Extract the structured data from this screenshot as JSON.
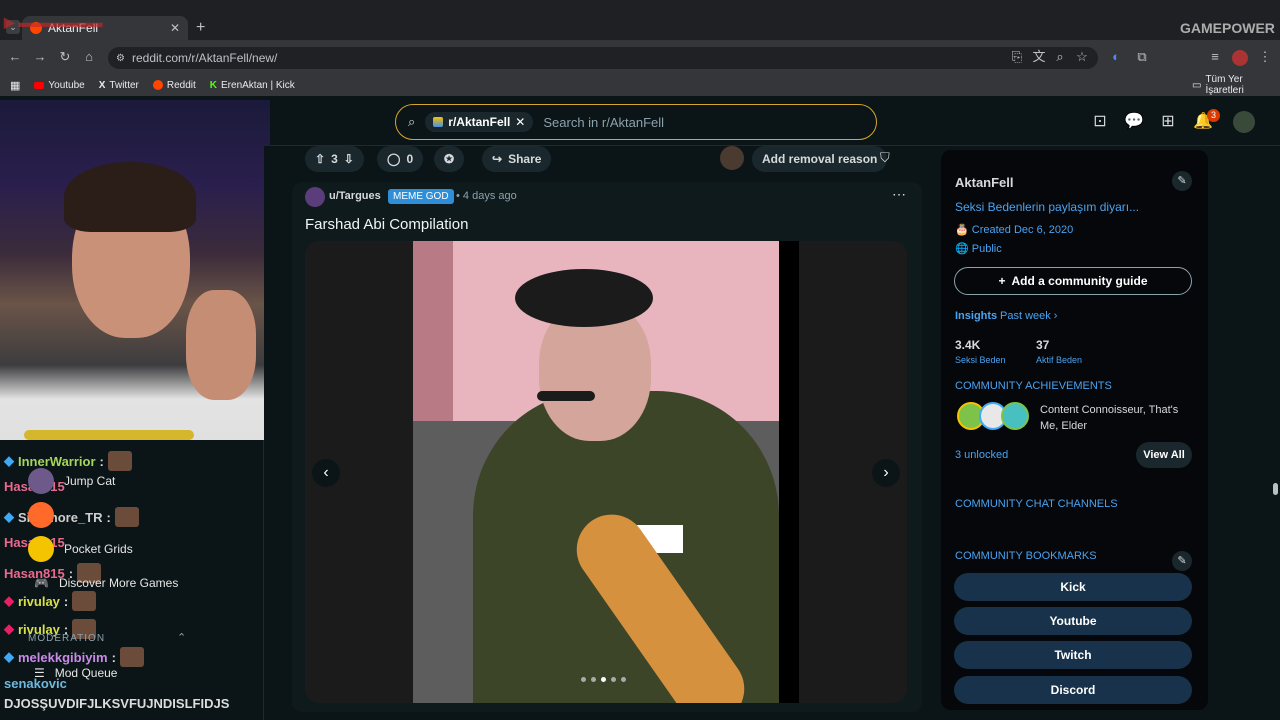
{
  "browser": {
    "tab_title": "AktanFell",
    "url": "reddit.com/r/AktanFell/new/",
    "bookmarks": [
      "Youtube",
      "Twitter",
      "Reddit",
      "ErenAktan | Kick"
    ],
    "all_bookmarks": "Tüm Yer İşaretleri",
    "overlay_brand": "GAMEPOWER"
  },
  "header": {
    "community_chip": "r/AktanFell",
    "search_placeholder": "Search in r/AktanFell",
    "notification_count": "3"
  },
  "post_actions": {
    "votes": "3",
    "comments": "0",
    "share": "Share",
    "removal": "Add removal reason"
  },
  "post": {
    "author": "u/Targues",
    "flair": "MEME GOD",
    "time": "4 days ago",
    "title": "Farshad Abi Compilation"
  },
  "sidebar": {
    "name": "AktanFell",
    "description": "Seksi Bedenlerin paylaşım diyarı...",
    "created": "Created Dec 6, 2020",
    "visibility": "Public",
    "guide_button": "Add a community guide",
    "insights_label": "Insights",
    "insights_period": "Past week",
    "stat1_value": "3.4K",
    "stat1_label": "Seksi Beden",
    "stat2_value": "37",
    "stat2_label": "Aktif Beden",
    "achievements_heading": "COMMUNITY ACHIEVEMENTS",
    "achievements_text": "Content Connoisseur, That's Me, Elder",
    "unlocked": "3 unlocked",
    "view_all": "View All",
    "chat_heading": "COMMUNITY CHAT CHANNELS",
    "bookmarks_heading": "COMMUNITY BOOKMARKS",
    "bookmark_links": [
      "Kick",
      "Youtube",
      "Twitch",
      "Discord"
    ]
  },
  "stream": {
    "chat": [
      {
        "user": "InnerWarrior",
        "color": "#a5d65c"
      },
      {
        "user": "Hasan815",
        "color": "#e96a8f"
      },
      {
        "user": "Sinomore_TR",
        "color": "#cfcfcf"
      },
      {
        "user": "Hasan815",
        "color": "#e96a8f"
      },
      {
        "user": "Hasan815",
        "color": "#e96a8f"
      },
      {
        "user": "rivulay",
        "color": "#d8e04a"
      },
      {
        "user": "rivulay",
        "color": "#d8e04a"
      },
      {
        "user": "melekkgibiyim",
        "color": "#c98be8"
      },
      {
        "user": "senakovic",
        "color": "#6fb8e0"
      }
    ],
    "nav": [
      "Jump Cat",
      "Pocket Grids",
      "Discover More Games",
      "Mod Queue"
    ],
    "moderation": "MODERATION",
    "ticker": "DJOSŞUVDIFJLKSVFUJNDISLFIDJS"
  }
}
